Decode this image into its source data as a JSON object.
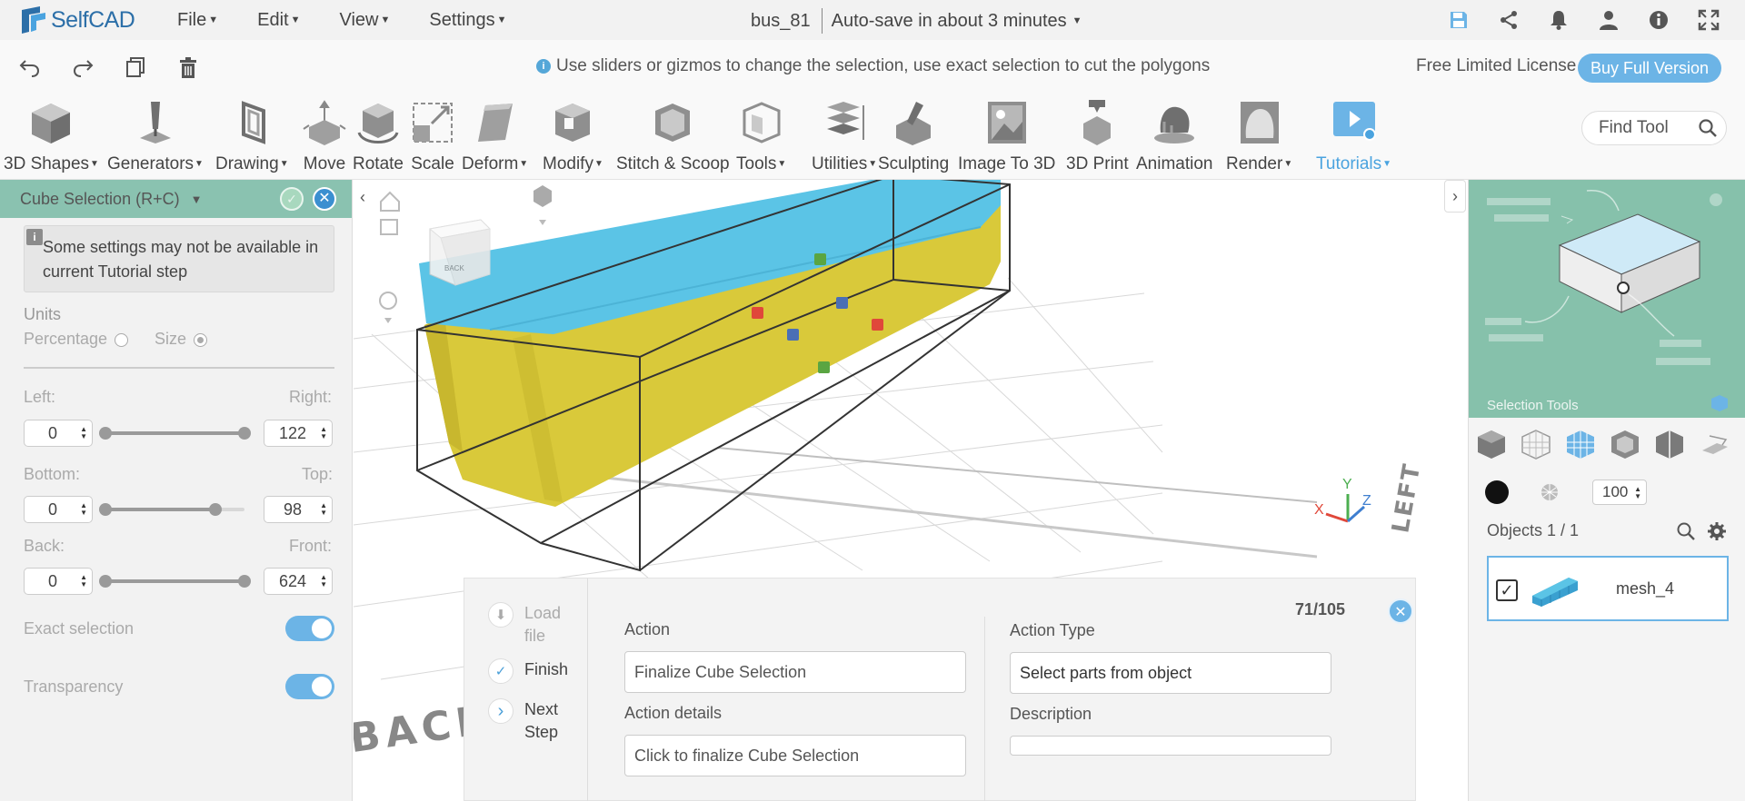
{
  "app": {
    "name": "SelfCAD",
    "brand_color": "#2c6fa8"
  },
  "menu": {
    "items": [
      {
        "label": "File"
      },
      {
        "label": "Edit"
      },
      {
        "label": "View"
      },
      {
        "label": "Settings"
      }
    ]
  },
  "document": {
    "title": "bus_81",
    "autosave": "Auto-save in about 3 minutes"
  },
  "top_icons": [
    "save-icon",
    "share-icon",
    "bell-icon",
    "user-icon",
    "help-icon",
    "fullscreen-icon"
  ],
  "secondbar": {
    "hint": "Use sliders or gizmos to change the selection, use exact selection to cut the polygons",
    "license": "Free Limited License",
    "buy_label": "Buy Full Version"
  },
  "toolbar": {
    "tools": [
      {
        "label": "3D Shapes",
        "dropdown": true
      },
      {
        "label": "Generators",
        "dropdown": true
      },
      {
        "label": "Drawing",
        "dropdown": true
      },
      {
        "label": "Move",
        "dropdown": false
      },
      {
        "label": "Rotate",
        "dropdown": false
      },
      {
        "label": "Scale",
        "dropdown": false
      },
      {
        "label": "Deform",
        "dropdown": true
      },
      {
        "label": "Modify",
        "dropdown": true
      },
      {
        "label": "Stitch & Scoop",
        "dropdown": false
      },
      {
        "label": "Tools",
        "dropdown": true
      },
      {
        "label": "Utilities",
        "dropdown": true
      },
      {
        "label": "Sculpting",
        "dropdown": false
      },
      {
        "label": "Image To 3D",
        "dropdown": false
      },
      {
        "label": "3D Print",
        "dropdown": false
      },
      {
        "label": "Animation",
        "dropdown": false
      },
      {
        "label": "Render",
        "dropdown": true
      },
      {
        "label": "Tutorials",
        "dropdown": true
      }
    ],
    "find_placeholder": "Find Tool"
  },
  "left_panel": {
    "title": "Cube Selection (R+C)",
    "notice": "Some settings may not be available in current Tutorial step",
    "units_label": "Units",
    "unit_percentage": "Percentage",
    "unit_size": "Size",
    "selected_unit": "Size",
    "left_label": "Left:",
    "right_label": "Right:",
    "left_value": "0",
    "right_value": "122",
    "bottom_label": "Bottom:",
    "top_label": "Top:",
    "bottom_value": "0",
    "top_value": "98",
    "back_label": "Back:",
    "front_label": "Front:",
    "back_value": "0",
    "front_value": "624",
    "exact_selection_label": "Exact selection",
    "exact_selection_on": true,
    "transparency_label": "Transparency",
    "transparency_on": true,
    "header_color": "#8ac2b0"
  },
  "viewport": {
    "viewcube_back": "BACK",
    "floor_back": "BACK",
    "floor_left": "LEFT",
    "axis_x": "X",
    "axis_y": "Y",
    "axis_z": "Z",
    "colors": {
      "selected": "#5bc4e6",
      "mesh": "#d9c93a"
    }
  },
  "tutorial": {
    "steps": [
      {
        "label": "Load file",
        "state": "muted"
      },
      {
        "label": "Finish",
        "state": "done"
      },
      {
        "label": "Next Step",
        "state": "next"
      }
    ],
    "action_label": "Action",
    "action_value": "Finalize Cube Selection",
    "action_details_label": "Action details",
    "action_details_value": "Click to finalize Cube Selection",
    "action_type_label": "Action Type",
    "action_type_value": "Select parts from object",
    "description_label": "Description",
    "description_value": "",
    "counter": "71/105"
  },
  "right_panel": {
    "selection_tools_label": "Selection Tools",
    "opacity_value": "100",
    "objects_title": "Objects 1 / 1",
    "object_name": "mesh_4",
    "accent": "#6cb4e6"
  }
}
